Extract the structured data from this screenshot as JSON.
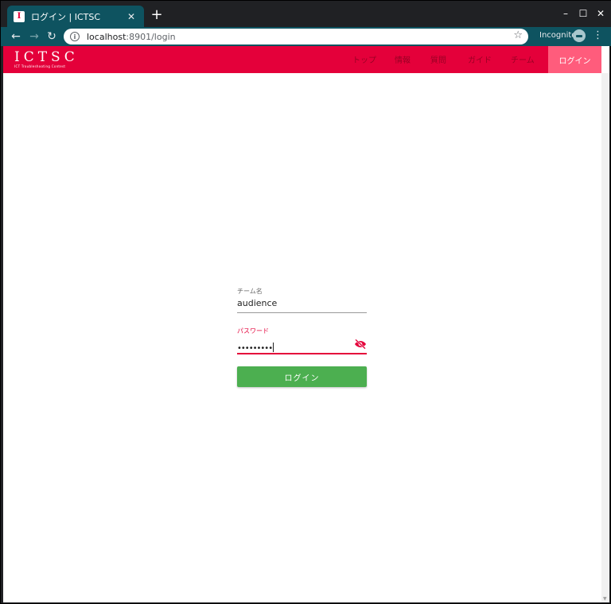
{
  "browser": {
    "tab_title": "ログイン | ICTSC",
    "tab_favicon_letter": "I",
    "tab_close": "✕",
    "new_tab": "+",
    "back": "←",
    "forward": "→",
    "reload": "↻",
    "url_host": "localhost",
    "url_path": ":8901/login",
    "info": "i",
    "star": "☆",
    "incognito_label": "Incognito",
    "menu": "⋮",
    "minimize": "–",
    "maximize": "☐",
    "close": "✕"
  },
  "site": {
    "logo_text": "ICTSC",
    "logo_subtitle": "ICT Troubleshooting Contest",
    "nav": [
      "トップ",
      "情報",
      "質問",
      "ガイド",
      "チーム"
    ],
    "login_nav": "ログイン",
    "brand_color": "#e4003a",
    "login_nav_color": "#ff5c7c"
  },
  "form": {
    "team_label": "チーム名",
    "team_value": "audience",
    "password_label": "パスワード",
    "password_value": "•••••••••",
    "submit_label": "ログイン",
    "submit_color": "#4caf50"
  },
  "icons": {
    "password_toggle": "eye-off-icon"
  }
}
